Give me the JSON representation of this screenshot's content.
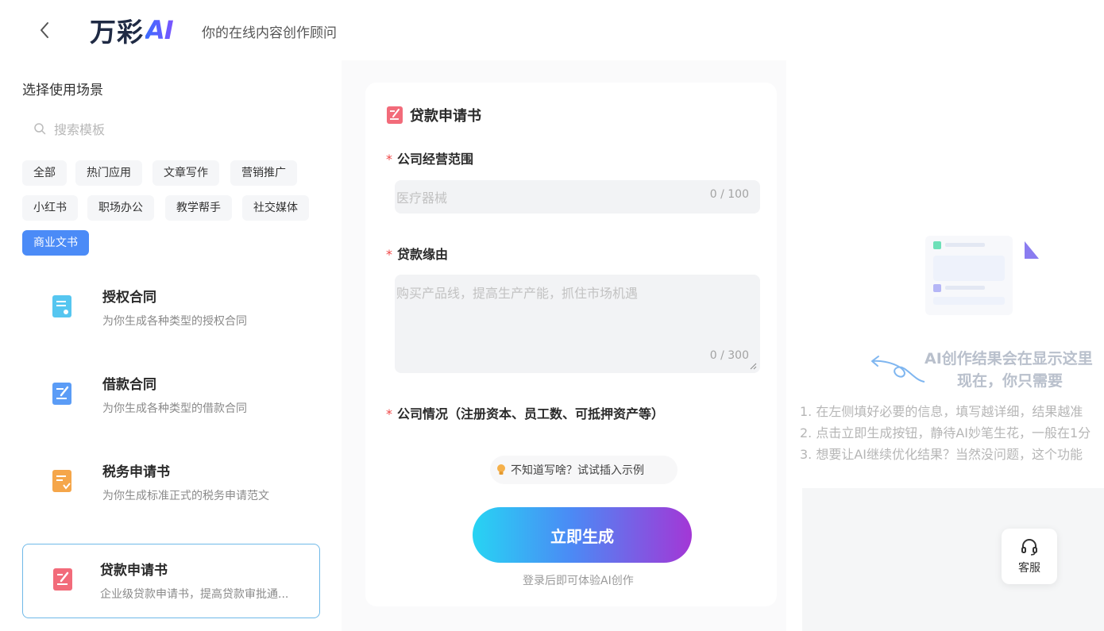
{
  "header": {
    "logo_cn": "万彩",
    "logo_ai": "AI",
    "slogan": "你的在线内容创作顾问"
  },
  "sidebar": {
    "title": "选择使用场景",
    "search_placeholder": "搜索模板",
    "tags": [
      {
        "label": "全部",
        "active": false
      },
      {
        "label": "热门应用",
        "active": false
      },
      {
        "label": "文章写作",
        "active": false
      },
      {
        "label": "营销推广",
        "active": false
      },
      {
        "label": "小红书",
        "active": false
      },
      {
        "label": "职场办公",
        "active": false
      },
      {
        "label": "教学帮手",
        "active": false
      },
      {
        "label": "社交媒体",
        "active": false
      },
      {
        "label": "商业文书",
        "active": true
      }
    ],
    "templates": [
      {
        "name": "授权合同",
        "desc": "为你生成各种类型的授权合同",
        "icon": "contract-icon",
        "color": "#56c6f0",
        "selected": false
      },
      {
        "name": "借款合同",
        "desc": "为你生成各种类型的借款合同",
        "icon": "loan-contract-icon",
        "color": "#5b9cf6",
        "selected": false
      },
      {
        "name": "税务申请书",
        "desc": "为你生成标准正式的税务申请范文",
        "icon": "tax-icon",
        "color": "#f5a64a",
        "selected": false
      },
      {
        "name": "贷款申请书",
        "desc": "企业级贷款申请书，提高贷款审批通...",
        "icon": "loan-application-icon",
        "color": "#f26b7a",
        "selected": true
      }
    ]
  },
  "form": {
    "title": "贷款申请书",
    "fields": [
      {
        "label": "公司经营范围",
        "placeholder": "医疗器械",
        "counter": "0 / 100",
        "required": true
      },
      {
        "label": "贷款缘由",
        "placeholder": "购买产品线，提高生产产能，抓住市场机遇",
        "counter": "0 / 300",
        "required": true
      },
      {
        "label": "公司情况（注册资本、员工数、可抵押资产等）",
        "required": true
      }
    ],
    "example_button": "不知道写啥？试试插入示例",
    "generate_button": "立即生成",
    "login_tip": "登录后即可体验AI创作"
  },
  "result": {
    "title": "AI创作结果会在显示这里",
    "subtitle": "现在，你只需要",
    "steps": [
      "1. 在左侧填好必要的信息，填写越详细，结果越准",
      "2. 点击立即生成按钮，静待AI妙笔生花，一般在1分",
      "3. 想要让AI继续优化结果？当然没问题，这个功能"
    ]
  },
  "service": {
    "label": "客服"
  },
  "colors": {
    "accent": "#4b8bf7",
    "required": "#f04848"
  }
}
